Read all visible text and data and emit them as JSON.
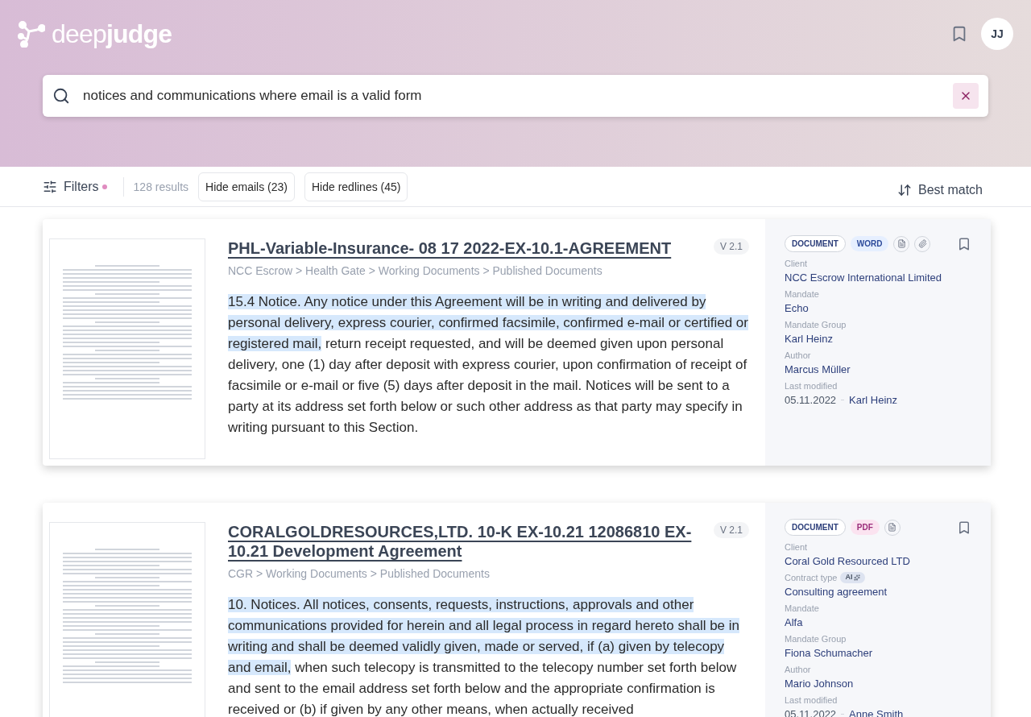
{
  "header": {
    "logo": "deep**judge**",
    "avatar": "JJ"
  },
  "search": {
    "value": "notices and communications where email is a valid form"
  },
  "toolbar": {
    "filters": "Filters",
    "filters_active": true,
    "results": "128 results",
    "chips": [
      {
        "label": "Hide emails",
        "count": "(23)"
      },
      {
        "label": "Hide redlines",
        "count": "(45)"
      }
    ],
    "sort": "Best match"
  },
  "results": [
    {
      "title": "PHL-Variable-Insurance- 08 17 2022-EX-10.1-AGREEMENT",
      "version": "V 2.1",
      "breadcrumb": "NCC Escrow > Health Gate > Working Documents > Published Documents",
      "highlight": "15.4 Notice. Any notice under this Agreement will be in writing and delivered by personal delivery, express courier, confirmed facsimile, confirmed e-mail or certified or registered mail,",
      "rest": " return receipt requested, and will be deemed given upon personal delivery, one (1) day after deposit with express courier, upon confirmation of receipt of facsimile or e-mail or five (5) days after deposit in the mail. Notices will be sent to a party at its address set forth below or such other address as that party may specify in writing pursuant to this Section.",
      "tags": [
        {
          "label": "DOCUMENT",
          "kind": "outline"
        },
        {
          "label": "WORD",
          "kind": "word"
        }
      ],
      "has_attachments": true,
      "bookmarked": false,
      "meta": [
        {
          "kind": "text",
          "label": "Client",
          "value": "NCC Escrow International Limited",
          "ai": false
        },
        {
          "kind": "text",
          "label": "Mandate",
          "value": "Echo",
          "ai": false
        },
        {
          "kind": "text",
          "label": "Mandate Group",
          "value": "Karl Heinz",
          "ai": false
        },
        {
          "kind": "text",
          "label": "Author",
          "value": "Marcus Müller",
          "ai": false
        },
        {
          "kind": "modified",
          "label": "Last modified",
          "date": "05.11.2022",
          "value": "Karl Heinz",
          "ai": false
        }
      ]
    },
    {
      "title": "CORALGOLDRESOURCES,LTD. 10-K EX-10.21 12086810 EX-10.21 Development Agreement",
      "version": "V 2.1",
      "breadcrumb": "CGR > Working Documents > Published Documents",
      "highlight": "10. Notices. All notices, consents, requests, instructions, approvals and other communications provided for herein and all legal process in regard hereto shall be in writing and shall be deemed validly given, made or served, if (a) given by telecopy and email,",
      "rest": " when such telecopy is transmitted to the telecopy number set forth below and sent to the email address set forth below and the appropriate confirmation is received or (b) if given by any other means, when actually received",
      "tags": [
        {
          "label": "DOCUMENT",
          "kind": "outline"
        },
        {
          "label": "PDF",
          "kind": "pdf"
        }
      ],
      "has_attachments": false,
      "bookmarked": false,
      "meta": [
        {
          "kind": "text",
          "label": "Client",
          "value": "Coral Gold Resourced LTD",
          "ai": false
        },
        {
          "kind": "text",
          "label": "Contract type",
          "value": "Consulting agreement",
          "ai": true,
          "ai_label": "AI"
        },
        {
          "kind": "text",
          "label": "Mandate",
          "value": "Alfa",
          "ai": false
        },
        {
          "kind": "text",
          "label": "Mandate Group",
          "value": "Fiona Schumacher",
          "ai": false
        },
        {
          "kind": "text",
          "label": "Author",
          "value": "Mario Johnson",
          "ai": false
        },
        {
          "kind": "modified",
          "label": "Last modified",
          "date": "05.11.2022",
          "value": "Anne Smith",
          "ai": false
        }
      ]
    }
  ]
}
